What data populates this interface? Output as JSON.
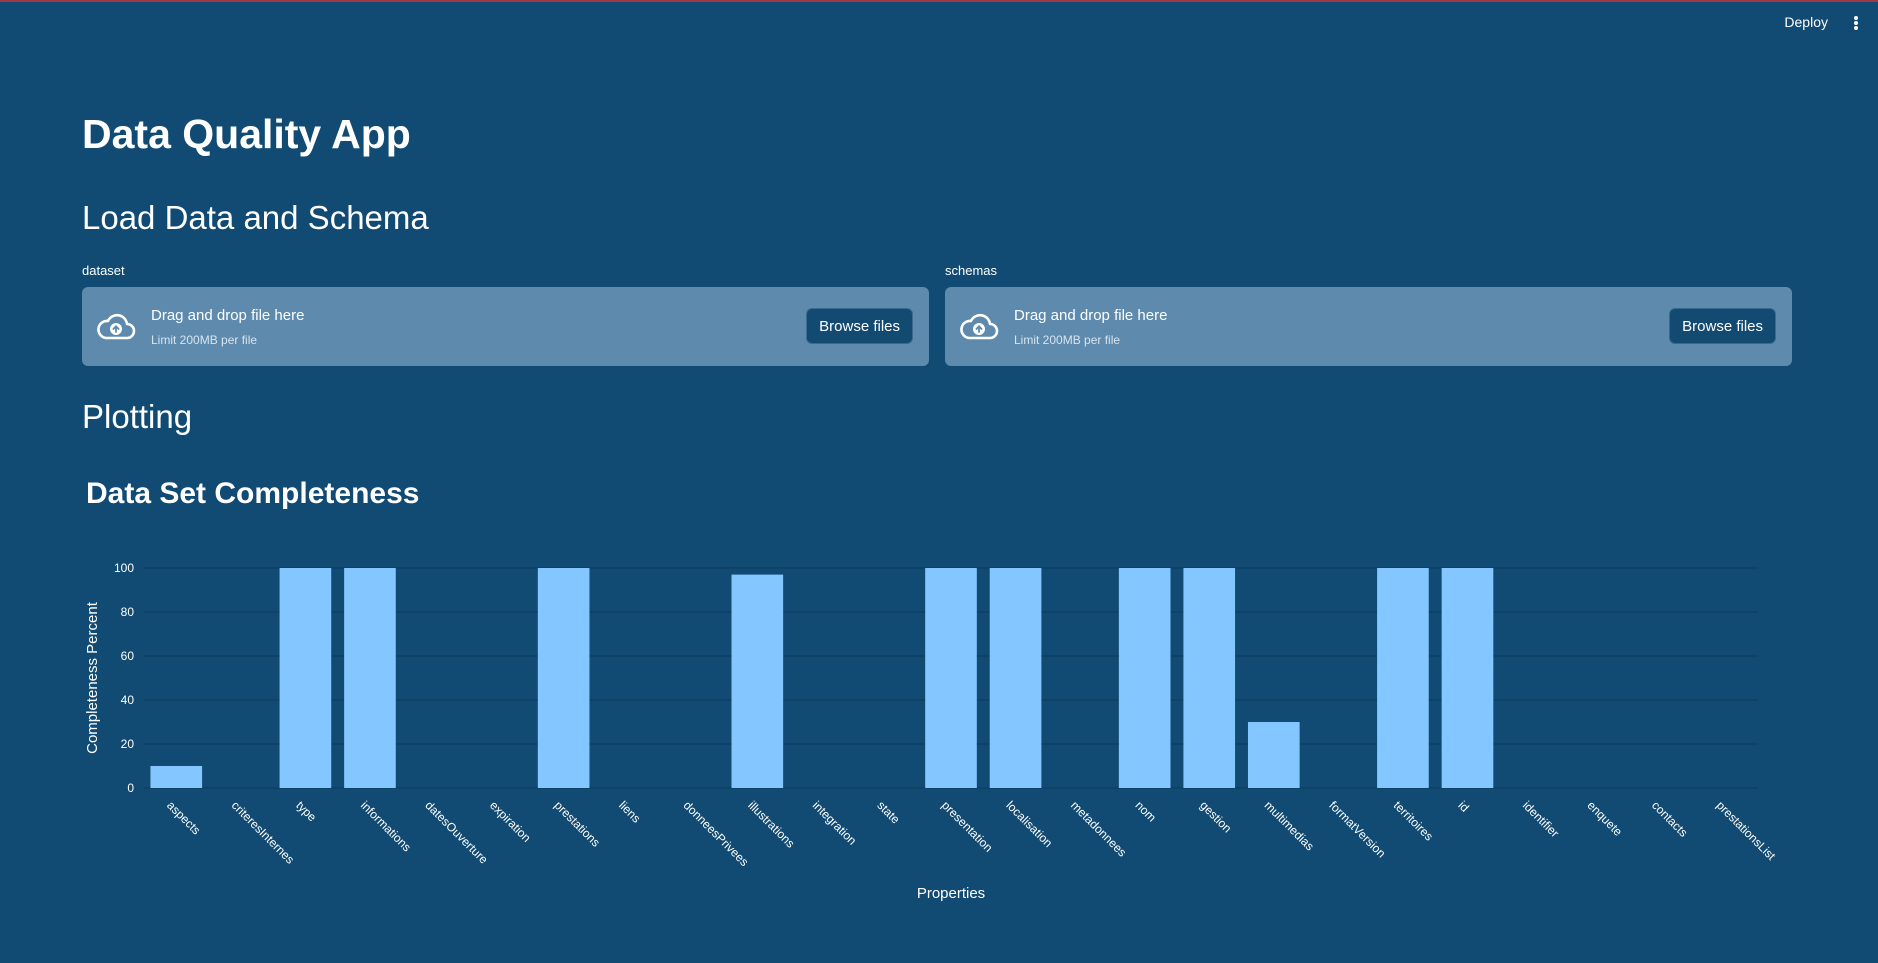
{
  "header": {
    "deploy_label": "Deploy"
  },
  "page": {
    "title": "Data Quality App",
    "load_section_title": "Load Data and Schema",
    "plot_section_title": "Plotting"
  },
  "uploaders": [
    {
      "label": "dataset",
      "drop_text": "Drag and drop file here",
      "limit_text": "Limit 200MB per file",
      "button_label": "Browse files"
    },
    {
      "label": "schemas",
      "drop_text": "Drag and drop file here",
      "limit_text": "Limit 200MB per file",
      "button_label": "Browse files"
    }
  ],
  "colors": {
    "background": "#114a72",
    "dropzone": "#5d8aad",
    "bar": "#84c6ff",
    "grid": "#0b3a5b"
  },
  "chart_data": {
    "type": "bar",
    "title": "Data Set Completeness",
    "xlabel": "Properties",
    "ylabel": "Completeness Percent",
    "ylim": [
      0,
      100
    ],
    "yticks": [
      0,
      20,
      40,
      60,
      80,
      100
    ],
    "grid": true,
    "categories": [
      "aspects",
      "criteresInternes",
      "type",
      "informations",
      "datesOuverture",
      "expiration",
      "prestations",
      "liens",
      "donneesPrivees",
      "illustrations",
      "integration",
      "state",
      "presentation",
      "localisation",
      "metadonnees",
      "nom",
      "gestion",
      "multimedias",
      "formatVersion",
      "territoires",
      "id",
      "identifier",
      "enquete",
      "contacts",
      "prestationsList"
    ],
    "values": [
      10,
      0,
      100,
      100,
      0,
      0,
      100,
      0,
      0,
      97,
      0,
      0,
      100,
      100,
      0,
      100,
      100,
      30,
      0,
      100,
      100,
      0,
      0,
      0,
      0
    ]
  }
}
